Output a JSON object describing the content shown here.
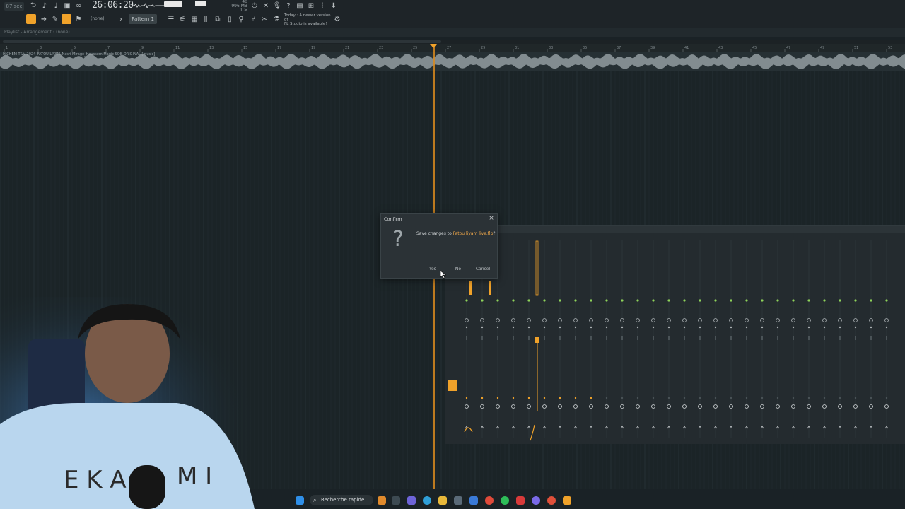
{
  "toolbar": {
    "cpu_label": "87 sec",
    "time": "26:06:20",
    "memory": [
      "40",
      "996 MB",
      "1 ≥"
    ],
    "snap_value": "(none)",
    "pattern": "Pattern 1",
    "news_line1": "Today : A newer version of",
    "news_line2": "FL Studio is available!"
  },
  "playlist": {
    "header": "Playlist - Arrangement › (none)",
    "track_label": "HICHEM T&V 2024_FATOU LIYAM_Nasri Mirage_Houssem Magic SOB ORIGINAL [music]",
    "ruler_marks": [
      "1",
      "3",
      "5",
      "7",
      "9",
      "11",
      "13",
      "15",
      "17",
      "19",
      "21",
      "23",
      "25",
      "27",
      "29",
      "31",
      "33",
      "35",
      "37",
      "39",
      "41",
      "43",
      "45",
      "47",
      "49",
      "51",
      "53"
    ]
  },
  "dialog": {
    "title": "Confirm",
    "close": "×",
    "question_icon": "?",
    "message_prefix": "Save changes to ",
    "filename": "Fatou liyam live.flp",
    "message_suffix": "?",
    "yes": "Yes",
    "no": "No",
    "cancel": "Cancel"
  },
  "taskbar": {
    "search": "Recherche rapide",
    "icons": [
      "windows-start-icon",
      "search-icon",
      "widgets-icon",
      "task-view-icon",
      "teams-icon",
      "edge-icon",
      "file-explorer-icon",
      "store-icon",
      "chrome-icon",
      "spotify-icon",
      "winrar-icon",
      "discord-icon",
      "chrome-alt-icon",
      "fl-studio-icon"
    ]
  },
  "colors": {
    "accent": "#f0a22a",
    "background": "#1a2226",
    "dialog_bg": "#2b3236"
  }
}
